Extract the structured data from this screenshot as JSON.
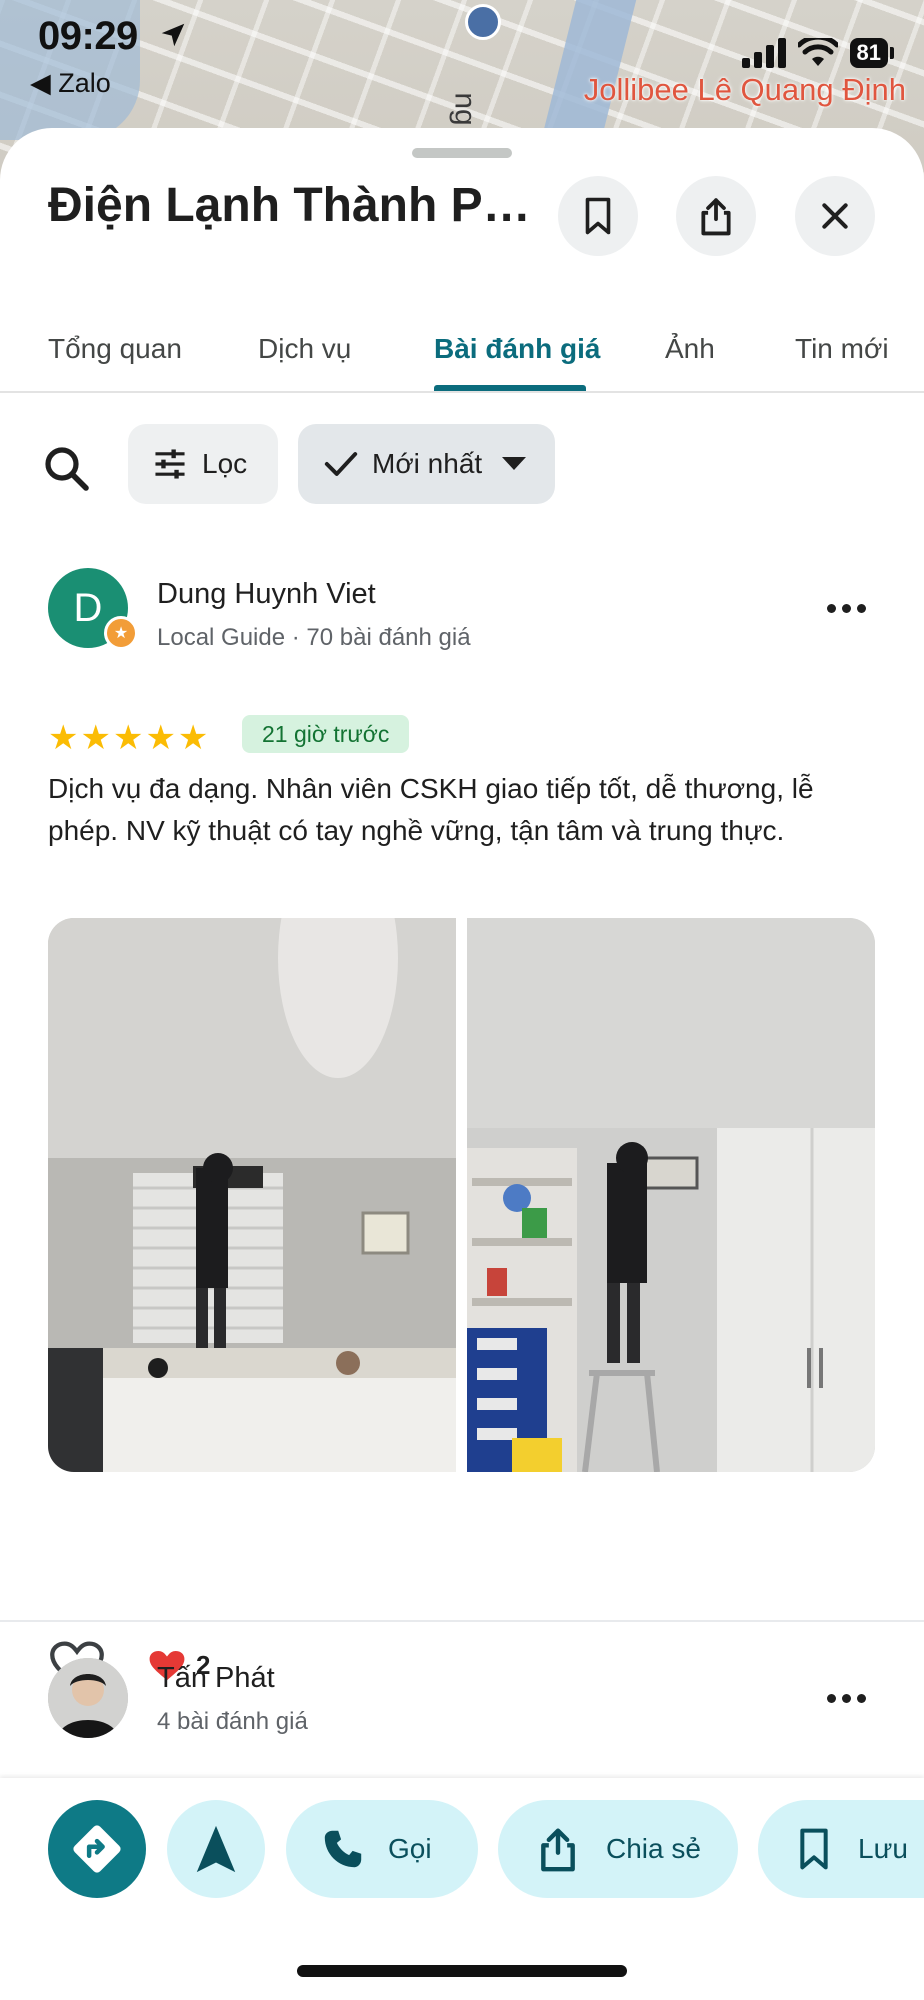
{
  "status_bar": {
    "time": "09:29",
    "back_app": "◀ Zalo",
    "battery": "81"
  },
  "map": {
    "label": "Jollibee Lê Quang Định",
    "street_fragment": "ng"
  },
  "place": {
    "title": "Điện Lạnh Thành Ph..."
  },
  "tabs": [
    {
      "label": "Tổng quan",
      "active": false
    },
    {
      "label": "Dịch vụ",
      "active": false
    },
    {
      "label": "Bài đánh giá",
      "active": true
    },
    {
      "label": "Ảnh",
      "active": false
    },
    {
      "label": "Tin mới",
      "active": false
    }
  ],
  "filters": {
    "filter_label": "Lọc",
    "sort_label": "Mới nhất"
  },
  "reviews": [
    {
      "avatar_letter": "D",
      "avatar_color": "#1a8f73",
      "name": "Dung Huynh Viet",
      "meta": "Local Guide · 70 bài đánh giá",
      "rating": 5,
      "stars": "★★★★★",
      "time": "21 giờ trước",
      "text": "Dịch vụ đa dạng. Nhân viên CSKH giao tiếp tốt, dễ thương, lễ phép. NV kỹ thuật có tay nghề vững, tận tâm và trung thực.",
      "reaction_count": "2"
    },
    {
      "name": "Tấn Phát",
      "meta": "4 bài đánh giá"
    }
  ],
  "bottom_actions": [
    {
      "icon": "directions-icon"
    },
    {
      "icon": "navigation-arrow-icon"
    },
    {
      "icon": "phone-icon",
      "label": "Gọi"
    },
    {
      "icon": "share-icon",
      "label": "Chia sẻ"
    },
    {
      "icon": "bookmark-icon",
      "label": "Lưu"
    }
  ],
  "colors": {
    "accent": "#0b6c7d",
    "star": "#fbbc04",
    "time_badge_bg": "#d6f2df",
    "action_bg": "#d3f3f8"
  }
}
